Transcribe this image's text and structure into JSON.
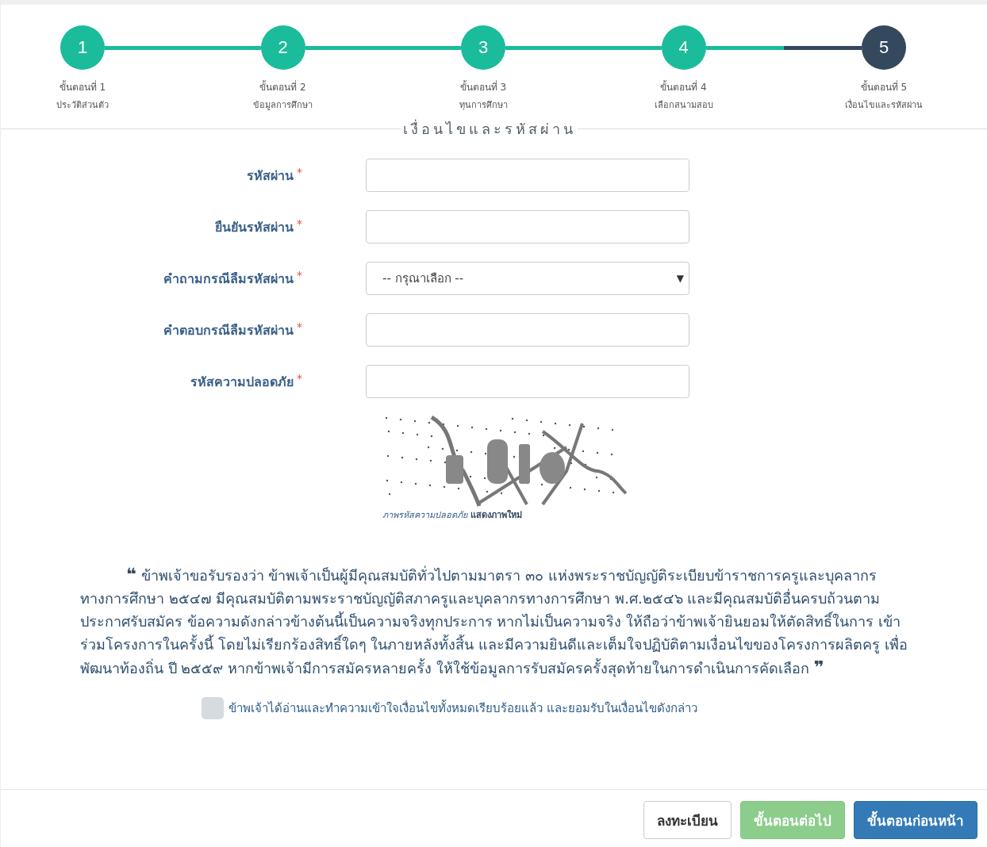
{
  "steps": [
    {
      "number": "1",
      "title": "ขั้นตอนที่ 1",
      "subtitle": "ประวัติส่วนตัว",
      "current": false
    },
    {
      "number": "2",
      "title": "ขั้นตอนที่ 2",
      "subtitle": "ข้อมูลการศึกษา",
      "current": false
    },
    {
      "number": "3",
      "title": "ขั้นตอนที่ 3",
      "subtitle": "ทุนการศึกษา",
      "current": false
    },
    {
      "number": "4",
      "title": "ขั้นตอนที่ 4",
      "subtitle": "เลือกสนามสอบ",
      "current": false
    },
    {
      "number": "5",
      "title": "ขั้นตอนที่ 5",
      "subtitle": "เงื่อนไขและรหัสผ่าน",
      "current": true
    }
  ],
  "section_title": "เงื่อนไขและรหัสผ่าน",
  "fields": [
    {
      "label": "รหัสผ่าน",
      "required": "*",
      "kind": "text"
    },
    {
      "label": "ยืนยันรหัสผ่าน",
      "required": "*",
      "kind": "text"
    },
    {
      "label": "คำถามกรณีลืมรหัสผ่าน",
      "required": "*",
      "kind": "select",
      "value": "-- กรุณาเลือก --",
      "arrow": "▼"
    },
    {
      "label": "คำตอบกรณีลืมรหัสผ่าน",
      "required": "*",
      "kind": "text"
    },
    {
      "label": "รหัสความปลอดภัย",
      "required": "*",
      "kind": "text"
    }
  ],
  "captcha": {
    "kind": "picture",
    "caption": "ภาพรหัสความปลอดภัย",
    "refresh_link": "แสดงภาพใหม่"
  },
  "agreement_text": "**❝** ข้าพเจ้าขอรับรองว่า ข้าพเจ้าเป็นผู้มีคุณสมบัติทั่วไปตามมาตรา ๓๐ แห่งพระราชบัญญัติระเบียบข้าราชการครูและบุคลากรทางการศึกษา ๒๕๔๗ มีคุณสมบัติตามพระราชบัญญัติสภาครูและบุคลากรทางการศึกษา พ.ศ.๒๕๔๖ และมีคุณสมบัติอื่นครบถ้วนตามประกาศรับสมัคร ข้อความดังกล่าวข้างต้นนี้เป็นความจริงทุกประการ หากไม่เป็นความจริง ให้ถือว่าข้าพเจ้ายินยอมให้ตัดสิทธิ์ในการ เข้าร่วมโครงการในครั้งนี้ โดยไม่เรียกร้องสิทธิ์ใดๆ ในภายหลังทั้งสิ้น และมีความยินดีและเต็มใจปฏิบัติตามเงื่อนไขของโครงการผลิตครู เพื่อพัฒนาท้องถิ่น ปี ๒๕๕๙ หากข้าพเจ้ามีการสมัครหลายครั้ง ให้ใช้ข้อมูลการรับสมัครครั้งสุดท้ายในการดำเนินการคัดเลือก **❞**",
  "consent": {
    "label": "ข้าพเจ้าได้อ่านและทำความเข้าใจเงื่อนไขทั้งหมดเรียบร้อยแล้ว และยอมรับในเงื่อนไขดังกล่าว",
    "checked": false
  },
  "buttons": [
    {
      "label": "ลงทะเบียน",
      "kind": "default",
      "disabled": false
    },
    {
      "label": "ขั้นตอนต่อไป",
      "kind": "success",
      "disabled": true
    },
    {
      "label": "ขั้นตอนก่อนหน้า",
      "kind": "primary",
      "disabled": false
    }
  ]
}
